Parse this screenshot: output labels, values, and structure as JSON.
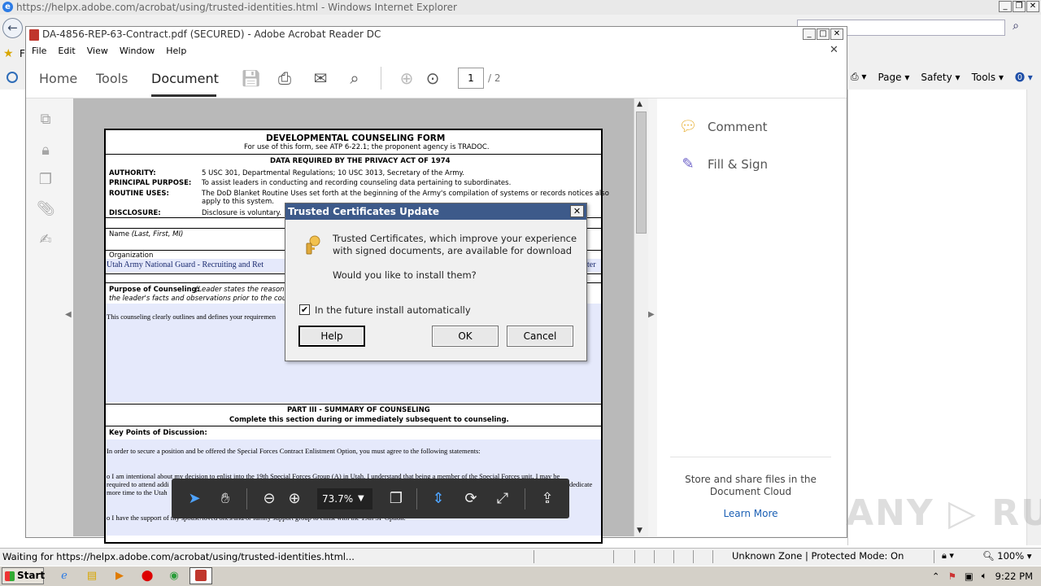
{
  "ie": {
    "title": "https://helpx.adobe.com/acrobat/using/trusted-identities.html - Windows Internet Explorer",
    "fav_letter": "F",
    "commands": [
      "Page ▾",
      "Safety ▾",
      "Tools ▾"
    ],
    "status_text": "Waiting for https://helpx.adobe.com/acrobat/using/trusted-identities.html...",
    "zone": "Unknown Zone | Protected Mode: On",
    "zoom": "100%"
  },
  "acrobat": {
    "title": "DA-4856-REP-63-Contract.pdf (SECURED) - Adobe Acrobat Reader DC",
    "menu": [
      "File",
      "Edit",
      "View",
      "Window",
      "Help"
    ],
    "tabs": {
      "home": "Home",
      "tools": "Tools",
      "document": "Document"
    },
    "page_current": "1",
    "page_total": "/ 2",
    "zoom_value": "73.7%",
    "right_panel": {
      "comment": "Comment",
      "fill_sign": "Fill & Sign",
      "store_line1": "Store and share files in the",
      "store_line2": "Document Cloud",
      "learn_more": "Learn More"
    }
  },
  "form": {
    "title": "DEVELOPMENTAL COUNSELING FORM",
    "subtitle": "For use of this form, see ATP 6-22.1; the proponent agency is TRADOC.",
    "privacy_head": "DATA REQUIRED BY THE PRIVACY ACT OF 1974",
    "authority_label": "AUTHORITY:",
    "authority_text": "5 USC 301, Departmental Regulations; 10 USC 3013, Secretary of the Army.",
    "purpose_label": "PRINCIPAL PURPOSE:",
    "purpose_text": "To assist leaders in conducting and recording counseling data pertaining to subordinates.",
    "routine_label": "ROUTINE USES:",
    "routine_text1": "The DoD Blanket Routine Uses set forth at the beginning of the Army's compilation of systems or records notices also",
    "routine_text2": "apply to this system.",
    "disclosure_label": "DISCLOSURE:",
    "disclosure_text": "Disclosure is voluntary.",
    "name_label": "Name",
    "name_hint": "(Last, First, MI)",
    "org_label": "Organization",
    "org_value": "Utah Army National Guard - Recruiting and Ret",
    "org_value_right": "ter",
    "purpose_counsel_label": "Purpose of Counseling:",
    "purpose_counsel_hint1": "(Leader states the reason f",
    "purpose_counsel_hint2": "the leader's facts and observations prior to the counse",
    "purpose_counsel_value": "This counseling clearly outlines and defines your requiremen",
    "part3_head": "PART III - SUMMARY OF COUNSELING",
    "part3_sub": "Complete this section during or immediately subsequent to counseling.",
    "key_points_label": "Key Points of Discussion:",
    "key_points_1": "In order to secure a position and be offered the Special Forces Contract Enlistment Option, you must agree to the following statements:",
    "key_points_2a": "o I am intentional about my decision to enlist into the 19th Special Forces Group (A) in Utah.  I understand that being a member of the Special Forces unit, I may be",
    "key_points_2b": "required to attend addi",
    "key_points_2c": "dedicate",
    "key_points_2d": "more time to the Utah",
    "key_points_3": "o I have the support of my spouse/loved ones/and/or family support group to enlist with the 19th SF Option."
  },
  "dialog": {
    "title": "Trusted Certificates Update",
    "message_line1": "Trusted Certificates, which improve your experience",
    "message_line2": "with signed documents, are available for download",
    "question": "Would you like to install them?",
    "checkbox_label": "In the future install automatically",
    "checkbox_checked": "✔",
    "help": "Help",
    "ok": "OK",
    "cancel": "Cancel"
  },
  "taskbar": {
    "start": "Start",
    "time": "9:22 PM"
  },
  "watermark": "ANY ▷ RUN",
  "colors": {
    "dialog_title_bg": "#3d5a8a",
    "form_fill": "#e5e9fb",
    "float_toolbar": "#323232",
    "accent_blue": "#4ea3ff"
  }
}
